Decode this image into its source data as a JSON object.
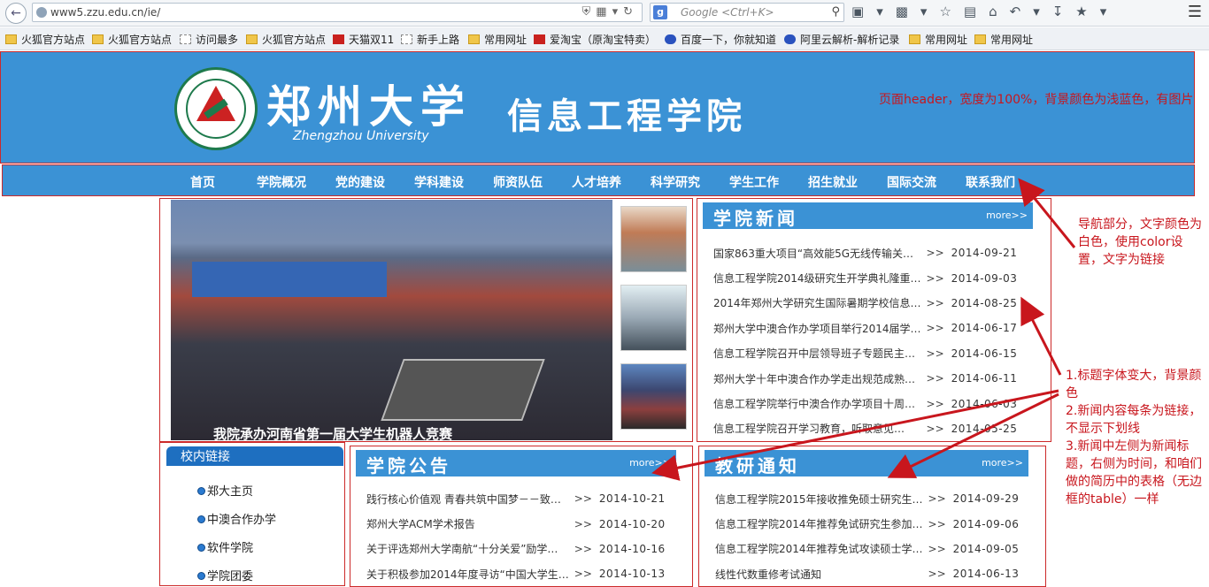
{
  "browser": {
    "url": "www5.zzu.edu.cn/ie/",
    "search_placeholder": "Google <Ctrl+K>",
    "search_engine_letter": "g"
  },
  "bookmarks": [
    {
      "label": "火狐官方站点",
      "icon": "folder-icon"
    },
    {
      "label": "火狐官方站点",
      "icon": "folder-icon"
    },
    {
      "label": "访问最多",
      "icon": "page-icon"
    },
    {
      "label": "火狐官方站点",
      "icon": "folder-icon"
    },
    {
      "label": "天猫双11",
      "icon": "tmall-icon"
    },
    {
      "label": "新手上路",
      "icon": "page-icon"
    },
    {
      "label": "常用网址",
      "icon": "folder-icon"
    },
    {
      "label": "爱淘宝（原淘宝特卖）",
      "icon": "taobao-icon"
    },
    {
      "label": "百度一下，你就知道",
      "icon": "baidu-icon"
    },
    {
      "label": "阿里云解析-解析记录",
      "icon": "aliyun-icon"
    },
    {
      "label": "常用网址",
      "icon": "folder-icon"
    },
    {
      "label": "常用网址",
      "icon": "folder-icon"
    }
  ],
  "header": {
    "logo_text": "郑州大学",
    "logo_sub": "Zhengzhou University",
    "college_name": "信息工程学院",
    "note": "页面header，宽度为100%，背景颜色为浅蓝色，有图片",
    "color": "#3b92d5"
  },
  "nav": {
    "items": [
      "首页",
      "学院概况",
      "党的建设",
      "学科建设",
      "师资队伍",
      "人才培养",
      "科学研究",
      "学生工作",
      "招生就业",
      "国际交流",
      "联系我们"
    ],
    "note": "导航部分，文字颜色为白色，使用color设置，文字为链接"
  },
  "slideshow": {
    "caption": "我院承办河南省第一届大学生机器人竞赛"
  },
  "news": {
    "title": "学院新闻",
    "more": "more>>",
    "arrow": ">>",
    "items": [
      {
        "title": "国家863重大项目“高效能5G无线传输关…",
        "date": "2014-09-21"
      },
      {
        "title": "信息工程学院2014级研究生开学典礼隆重…",
        "date": "2014-09-03"
      },
      {
        "title": "2014年郑州大学研究生国际暑期学校信息…",
        "date": "2014-08-25"
      },
      {
        "title": "郑州大学中澳合作办学项目举行2014届学…",
        "date": "2014-06-17"
      },
      {
        "title": "信息工程学院召开中层领导班子专题民主…",
        "date": "2014-06-15"
      },
      {
        "title": "郑州大学十年中澳合作办学走出规范成熟…",
        "date": "2014-06-11"
      },
      {
        "title": "信息工程学院举行中澳合作办学项目十周…",
        "date": "2014-06-03"
      },
      {
        "title": "信息工程学院召开学习教育，听取意见…",
        "date": "2014-05-25"
      }
    ],
    "note": "1.标题字体变大，背景颜色\n2.新闻内容每条为链接，不显示下划线\n3.新闻中左侧为新闻标题，右侧为时间，和咱们做的简历中的表格（无边框的table）一样"
  },
  "links": {
    "title": "校内链接",
    "items": [
      "郑大主页",
      "中澳合作办学",
      "软件学院",
      "学院团委"
    ]
  },
  "notice": {
    "title": "学院公告",
    "more": "more>>",
    "arrow": ">>",
    "items": [
      {
        "title": "践行核心价值观 青春共筑中国梦－－致…",
        "date": "2014-10-21"
      },
      {
        "title": "郑州大学ACM学术报告",
        "date": "2014-10-20"
      },
      {
        "title": "关于评选郑州大学南航“十分关爱”励学…",
        "date": "2014-10-16"
      },
      {
        "title": "关于积极参加2014年度寻访“中国大学生…",
        "date": "2014-10-13"
      }
    ]
  },
  "research": {
    "title": "教研通知",
    "more": "more>>",
    "arrow": ">>",
    "items": [
      {
        "title": "信息工程学院2015年接收推免硕士研究生…",
        "date": "2014-09-29"
      },
      {
        "title": "信息工程学院2014年推荐免试研究生参加…",
        "date": "2014-09-06"
      },
      {
        "title": "信息工程学院2014年推荐免试攻读硕士学…",
        "date": "2014-09-05"
      },
      {
        "title": "线性代数重修考试通知",
        "date": "2014-06-13"
      }
    ]
  },
  "colors": {
    "accent": "#3b92d5",
    "annotation": "#c8161d",
    "frame": "#cc2a2a"
  }
}
